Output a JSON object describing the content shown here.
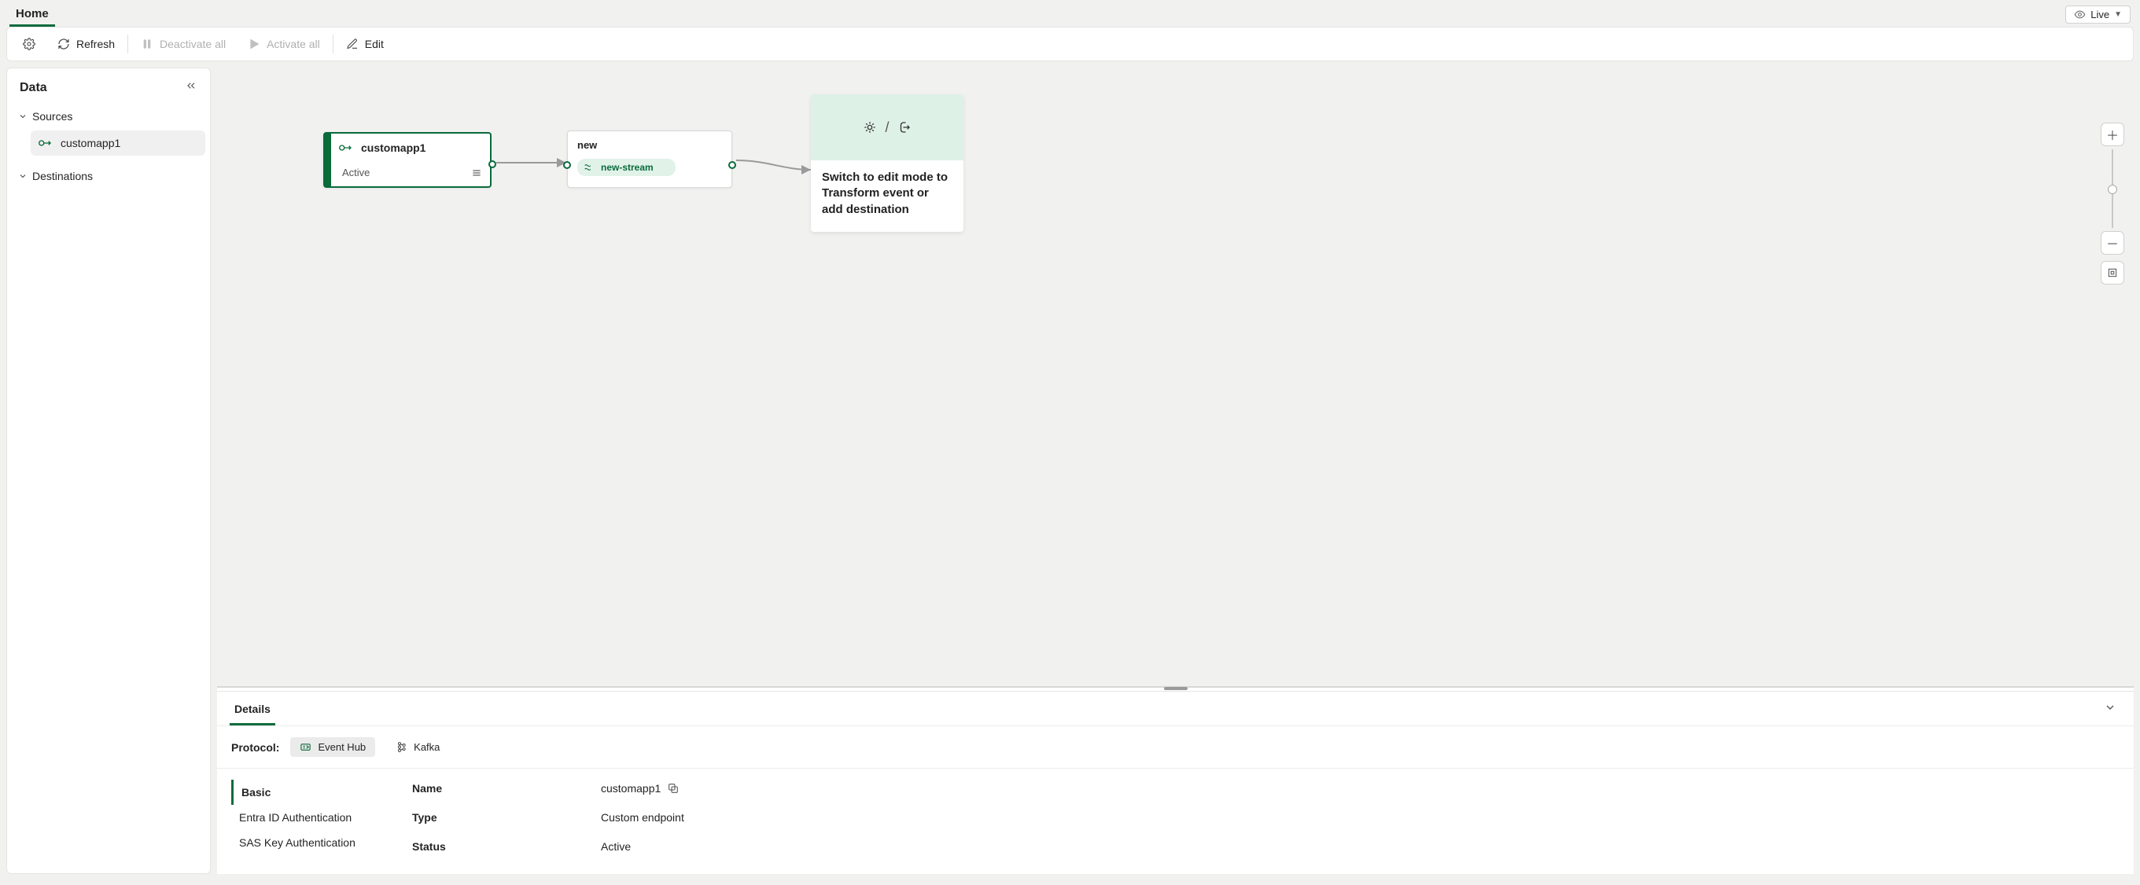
{
  "tabs": {
    "home": "Home"
  },
  "toolbar": {
    "live": "Live",
    "refresh": "Refresh",
    "deactivate": "Deactivate all",
    "activate": "Activate all",
    "edit": "Edit"
  },
  "sidebar": {
    "title": "Data",
    "sources": "Sources",
    "destinations": "Destinations",
    "items": {
      "custom": "customapp1"
    }
  },
  "canvas": {
    "source": {
      "title": "customapp1",
      "status": "Active"
    },
    "stream": {
      "title": "new",
      "chip": "new-stream"
    },
    "dest": {
      "message": "Switch to edit mode to Transform event or add destination"
    }
  },
  "details": {
    "tab": "Details",
    "protocol_label": "Protocol:",
    "protocols": {
      "eventhub": "Event Hub",
      "kafka": "Kafka"
    },
    "auth": {
      "basic": "Basic",
      "entra": "Entra ID Authentication",
      "sas": "SAS Key Authentication"
    },
    "kv": {
      "name_k": "Name",
      "name_v": "customapp1",
      "type_k": "Type",
      "type_v": "Custom endpoint",
      "status_k": "Status",
      "status_v": "Active"
    }
  }
}
